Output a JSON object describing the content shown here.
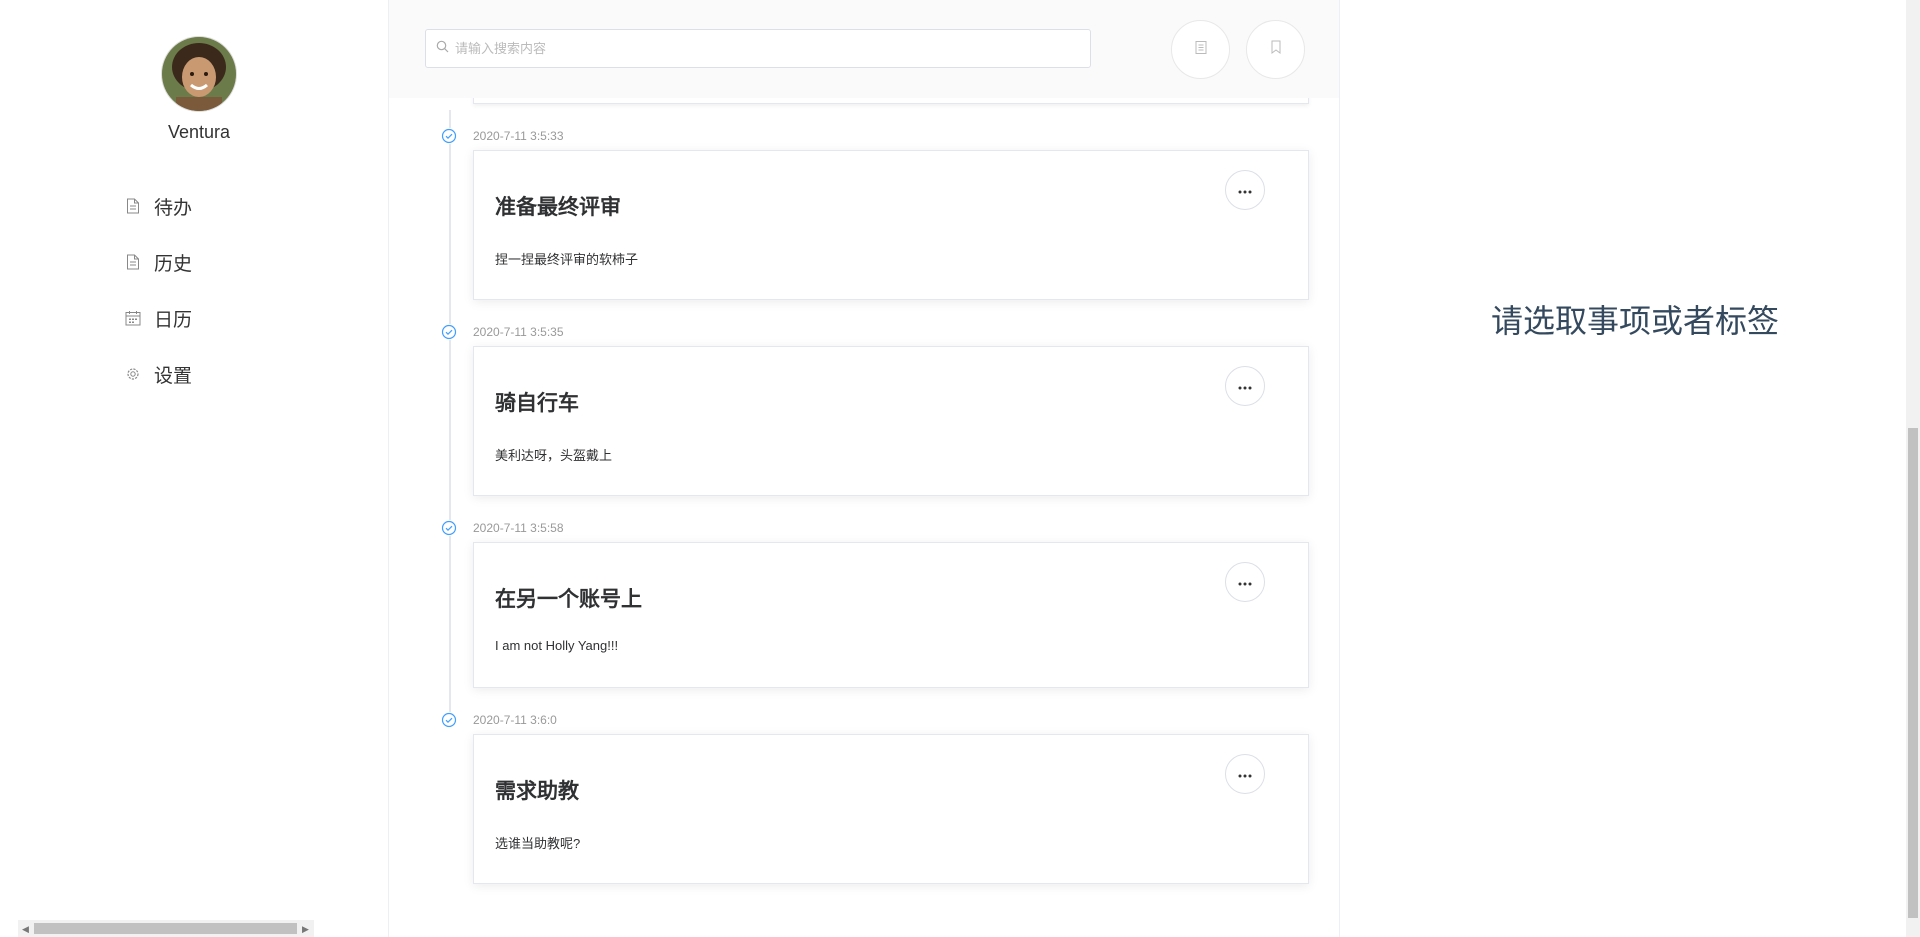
{
  "user": {
    "name": "Ventura"
  },
  "nav": [
    {
      "label": "待办",
      "icon": "document-icon"
    },
    {
      "label": "历史",
      "icon": "document-icon"
    },
    {
      "label": "日历",
      "icon": "calendar-icon"
    },
    {
      "label": "设置",
      "icon": "gear-icon"
    }
  ],
  "search": {
    "placeholder": "请输入搜索内容"
  },
  "toolbar": {
    "buttons": [
      "clipboard-icon",
      "bookmark-icon"
    ]
  },
  "entries": [
    {
      "timestamp": "2020-7-11 3:5:33",
      "title": "准备最终评审",
      "desc": "捏一捏最终评审的软柿子"
    },
    {
      "timestamp": "2020-7-11 3:5:35",
      "title": "骑自行车",
      "desc": "美利达呀，头盔戴上"
    },
    {
      "timestamp": "2020-7-11 3:5:58",
      "title": "在另一个账号上",
      "desc": "I am not Holly Yang!!!"
    },
    {
      "timestamp": "2020-7-11 3:6:0",
      "title": "需求助教",
      "desc": "选谁当助教呢?"
    }
  ],
  "detail": {
    "empty_text": "请选取事项或者标签"
  },
  "colors": {
    "accent": "#409eff",
    "text": "#303133",
    "muted": "#999999",
    "empty_text": "#34495e"
  }
}
